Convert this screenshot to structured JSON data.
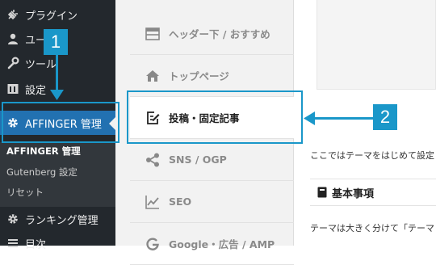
{
  "sidebar": {
    "items": [
      {
        "label": "プラグイン",
        "icon": "plugin-icon"
      },
      {
        "label": "ユーザー",
        "icon": "user-icon"
      },
      {
        "label": "ツール",
        "icon": "wrench-icon"
      },
      {
        "label": "設定",
        "icon": "settings-icon"
      },
      {
        "label": "AFFINGER 管理",
        "icon": "gear-icon",
        "active": true
      },
      {
        "label": "ランキング管理",
        "icon": "gear-icon"
      },
      {
        "label": "目次",
        "icon": "list-icon"
      }
    ],
    "submenu": [
      "AFFINGER 管理",
      "Gutenberg 設定",
      "リセット"
    ]
  },
  "tabs": [
    {
      "label": "ヘッダー下 / おすすめ",
      "icon": "header-layout-icon"
    },
    {
      "label": "トップページ",
      "icon": "home-icon"
    },
    {
      "label": "投稿・固定記事",
      "icon": "edit-icon",
      "selected": true
    },
    {
      "label": "SNS / OGP",
      "icon": "share-icon"
    },
    {
      "label": "SEO",
      "icon": "chart-icon"
    },
    {
      "label": "Google・広告 / AMP",
      "icon": "google-icon"
    }
  ],
  "content": {
    "intro": "ここではテーマをはじめて設定",
    "section_heading": "基本事項",
    "body": "テーマは大きく分けて「テーマ"
  },
  "annotations": {
    "badge1": "1",
    "badge2": "2"
  },
  "colors": {
    "sidebar_bg": "#23282d",
    "active_bg": "#2271b1",
    "accent": "#1a97c9",
    "tab_panel_bg": "#f2f2f2"
  }
}
